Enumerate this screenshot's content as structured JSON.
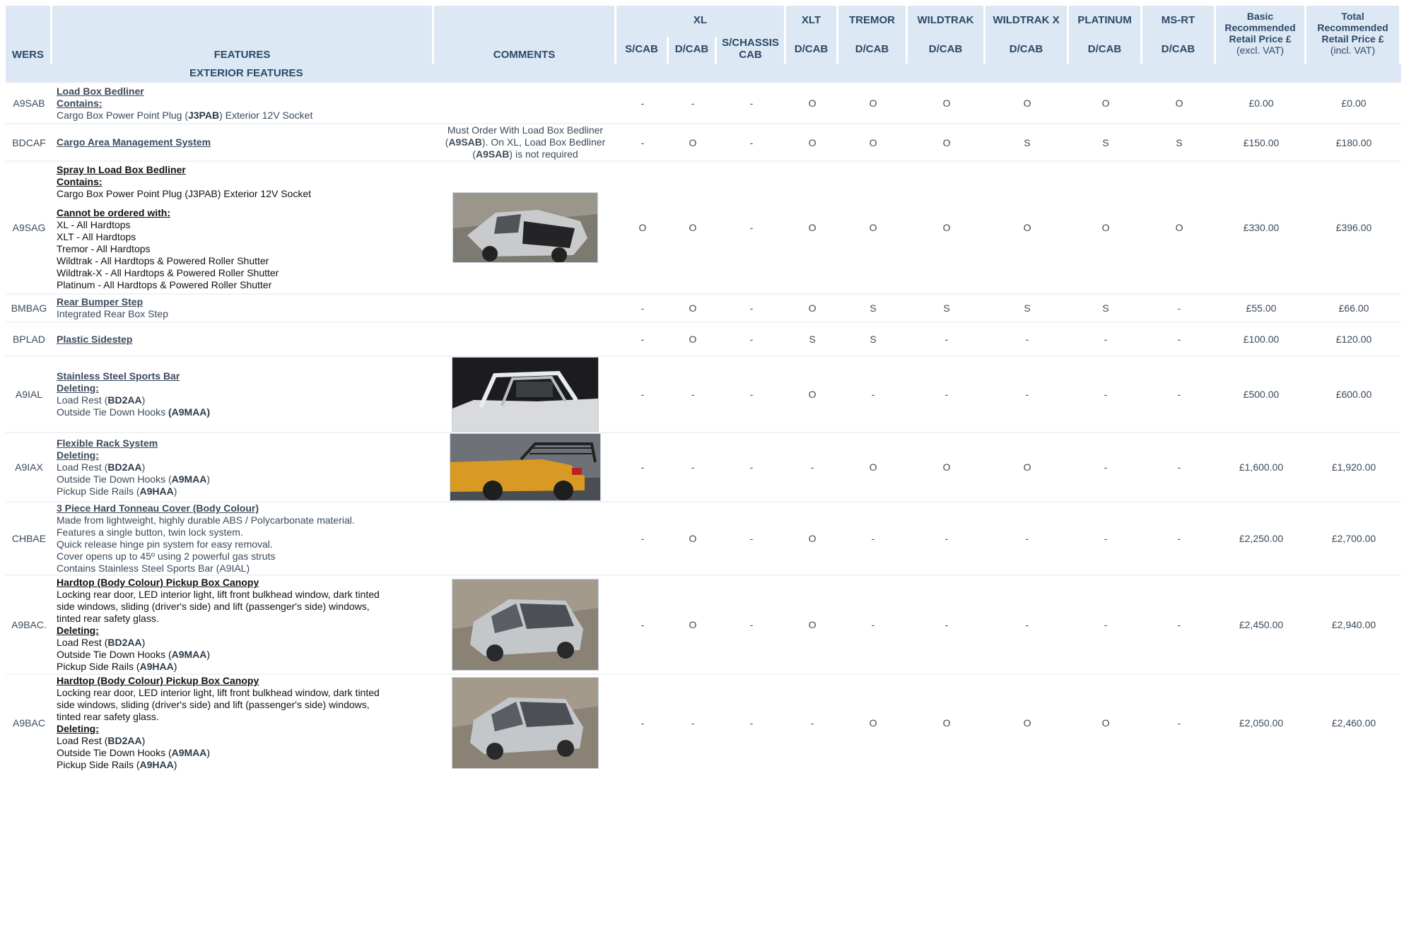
{
  "header": {
    "wers": "WERS",
    "features": "FEATURES",
    "comments": "COMMENTS",
    "groups": [
      {
        "label": "XL",
        "subs": [
          "S/CAB",
          "D/CAB",
          "S/CHASSIS CAB"
        ]
      },
      {
        "label": "XLT",
        "subs": [
          "D/CAB"
        ]
      },
      {
        "label": "TREMOR",
        "subs": [
          "D/CAB"
        ]
      },
      {
        "label": "WILDTRAK",
        "subs": [
          "D/CAB"
        ]
      },
      {
        "label": "WILDTRAK X",
        "subs": [
          "D/CAB"
        ]
      },
      {
        "label": "PLATINUM",
        "subs": [
          "D/CAB"
        ]
      },
      {
        "label": "MS-RT",
        "subs": [
          "D/CAB"
        ]
      }
    ],
    "basic_price": {
      "l1": "Basic",
      "l2": "Recommended",
      "l3": "Retail Price £",
      "l4": "(excl. VAT)"
    },
    "total_price": {
      "l1": "Total",
      "l2": "Recommended",
      "l3": "Retail Price £",
      "l4": "(incl. VAT)"
    }
  },
  "section": {
    "label": "EXTERIOR FEATURES"
  },
  "rows": [
    {
      "wers": "A9SAB",
      "title": "Load Box Bedliner",
      "lines": [
        [
          "h",
          "Contains:"
        ],
        [
          "t",
          "Cargo Box Power Point Plug (",
          "J3PAB",
          ") Exterior 12V Socket"
        ]
      ],
      "comment": [],
      "image": "",
      "cells": [
        "-",
        "-",
        "-",
        "O",
        "O",
        "O",
        "O",
        "O",
        "O"
      ],
      "basic": "£0.00",
      "total": "£0.00",
      "dark": false
    },
    {
      "wers": "BDCAF",
      "title": "Cargo Area Management System",
      "lines": [],
      "comment": [
        [
          "Must Order With Load Box Bedliner",
          "",
          ""
        ],
        [
          "(",
          "A9SAB",
          "). On XL, Load Box Bedliner"
        ],
        [
          "(",
          "A9SAB",
          ") is not required"
        ]
      ],
      "image": "",
      "cells": [
        "-",
        "O",
        "-",
        "O",
        "O",
        "O",
        "S",
        "S",
        "S"
      ],
      "basic": "£150.00",
      "total": "£180.00",
      "dark": false
    },
    {
      "wers": "A9SAG",
      "title": "Spray In Load Box Bedliner",
      "lines": [
        [
          "h",
          "Contains:"
        ],
        [
          "t",
          "Cargo Box Power Point Plug (J3PAB) Exterior 12V Socket"
        ],
        [
          "gap"
        ],
        [
          "h",
          "Cannot be ordered with:"
        ],
        [
          "t",
          "XL  - All Hardtops"
        ],
        [
          "t",
          "XLT - All Hardtops"
        ],
        [
          "t",
          "Tremor - All Hardtops"
        ],
        [
          "t",
          "Wildtrak - All Hardtops & Powered Roller Shutter"
        ],
        [
          "t",
          "Wildtrak-X -  All Hardtops & Powered Roller Shutter"
        ],
        [
          "t",
          "Platinum -  All Hardtops & Powered Roller Shutter"
        ]
      ],
      "comment": [],
      "image": "pickup-bedliner",
      "cells": [
        "O",
        "O",
        "-",
        "O",
        "O",
        "O",
        "O",
        "O",
        "O"
      ],
      "basic": "£330.00",
      "total": "£396.00",
      "dark": true
    },
    {
      "wers": "BMBAG",
      "title": "Rear Bumper Step",
      "lines": [
        [
          "t",
          "Integrated Rear Box Step"
        ]
      ],
      "comment": [],
      "image": "",
      "cells": [
        "-",
        "O",
        "-",
        "O",
        "S",
        "S",
        "S",
        "S",
        "-"
      ],
      "basic": "£55.00",
      "total": "£66.00",
      "dark": false
    },
    {
      "wers": "BPLAD",
      "title": "Plastic Sidestep",
      "lines": [],
      "comment": [],
      "image": "",
      "cells": [
        "-",
        "O",
        "-",
        "S",
        "S",
        "-",
        "-",
        "-",
        "-"
      ],
      "basic": "£100.00",
      "total": "£120.00",
      "dark": false
    },
    {
      "wers": "A9IAL",
      "title": "Stainless Steel Sports Bar",
      "lines": [
        [
          "h",
          "Deleting:"
        ],
        [
          "t",
          "Load Rest (",
          "BD2AA",
          ")"
        ],
        [
          "t",
          "Outside Tie Down Hooks ",
          "(A9MAA)",
          ""
        ]
      ],
      "comment": [],
      "image": "sports-bar",
      "cells": [
        "-",
        "-",
        "-",
        "O",
        "-",
        "-",
        "-",
        "-",
        "-"
      ],
      "basic": "£500.00",
      "total": "£600.00",
      "dark": false
    },
    {
      "wers": "A9IAX",
      "title": "Flexible Rack System",
      "lines": [
        [
          "h",
          "Deleting:"
        ],
        [
          "t",
          "Load Rest (",
          "BD2AA",
          ")"
        ],
        [
          "t",
          "Outside Tie Down Hooks (",
          "A9MAA",
          ")"
        ],
        [
          "t",
          "Pickup Side Rails (",
          "A9HAA",
          ")"
        ]
      ],
      "comment": [],
      "image": "rack-system",
      "cells": [
        "-",
        "-",
        "-",
        "-",
        "O",
        "O",
        "O",
        "-",
        "-"
      ],
      "basic": "£1,600.00",
      "total": "£1,920.00",
      "dark": false
    },
    {
      "wers": "CHBAE",
      "title": "3 Piece Hard Tonneau Cover (Body Colour)",
      "lines": [
        [
          "t",
          "Made from lightweight, highly durable ABS / Polycarbonate material."
        ],
        [
          "t",
          "Features a single button, twin lock system."
        ],
        [
          "t",
          "Quick release hinge pin system for easy removal."
        ],
        [
          "t",
          "Cover opens up to 45º using 2 powerful gas struts"
        ],
        [
          "t",
          "Contains Stainless Steel Sports Bar (A9IAL)"
        ]
      ],
      "comment": [],
      "image": "",
      "cells": [
        "-",
        "O",
        "-",
        "O",
        "-",
        "-",
        "-",
        "-",
        "-"
      ],
      "basic": "£2,250.00",
      "total": "£2,700.00",
      "dark": false
    },
    {
      "wers": "A9BAC.",
      "title": "Hardtop (Body Colour) Pickup Box Canopy",
      "lines": [
        [
          "t",
          "Locking rear door, LED interior light, lift front bulkhead window, dark tinted"
        ],
        [
          "t",
          "side windows, sliding (driver's side) and lift (passenger's side) windows,"
        ],
        [
          "t",
          "tinted rear safety glass."
        ],
        [
          "h",
          "Deleting:"
        ],
        [
          "t",
          "Load Rest (",
          "BD2AA",
          ")"
        ],
        [
          "t",
          "Outside Tie Down Hooks (",
          "A9MAA",
          ")"
        ],
        [
          "t",
          "Pickup Side Rails (",
          "A9HAA",
          ")"
        ]
      ],
      "comment": [],
      "image": "canopy",
      "cells": [
        "-",
        "O",
        "-",
        "O",
        "-",
        "-",
        "-",
        "-",
        "-"
      ],
      "basic": "£2,450.00",
      "total": "£2,940.00",
      "dark": true
    },
    {
      "wers": "A9BAC",
      "title": "Hardtop (Body Colour) Pickup Box Canopy",
      "lines": [
        [
          "t",
          "Locking rear door, LED interior light, lift front bulkhead window, dark tinted"
        ],
        [
          "t",
          "side windows, sliding (driver's side) and lift (passenger's side) windows,"
        ],
        [
          "t",
          "tinted rear safety glass."
        ],
        [
          "h",
          "Deleting:"
        ],
        [
          "t",
          "Load Rest (",
          "BD2AA",
          ")"
        ],
        [
          "t",
          "Outside Tie Down Hooks (",
          "A9MAA",
          ")"
        ],
        [
          "t",
          "Pickup Side Rails (",
          "A9HAA",
          ")"
        ]
      ],
      "comment": [],
      "image": "canopy",
      "cells": [
        "-",
        "-",
        "-",
        "-",
        "O",
        "O",
        "O",
        "O",
        "-"
      ],
      "basic": "£2,050.00",
      "total": "£2,460.00",
      "dark": true
    }
  ]
}
